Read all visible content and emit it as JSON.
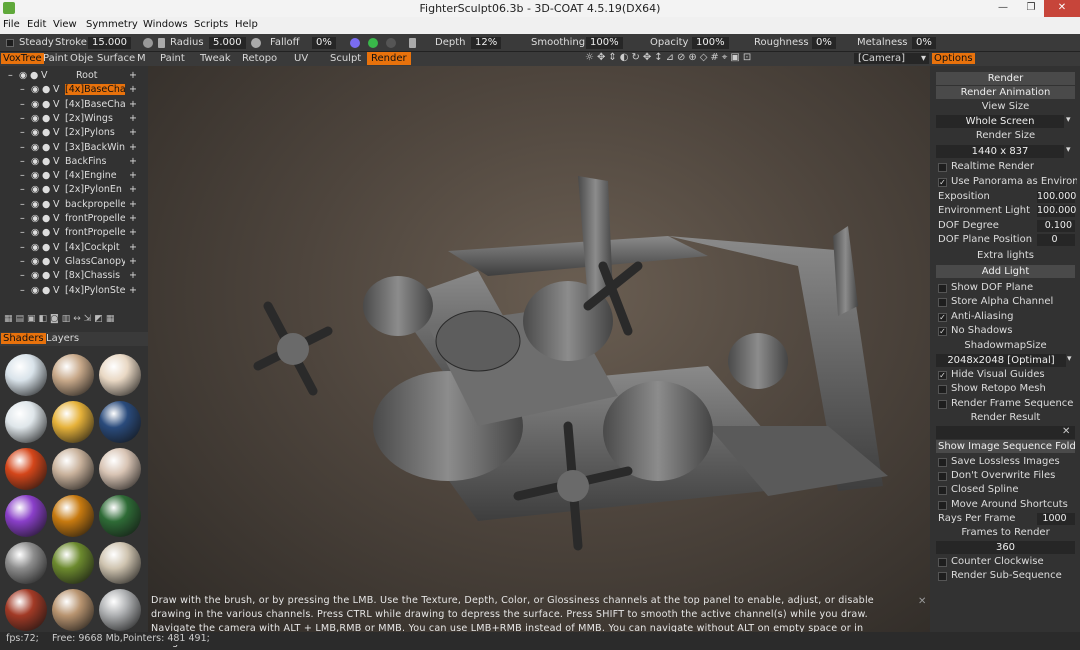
{
  "window": {
    "title": "FighterSculpt06.3b - 3D-COAT 4.5.19(DX64)",
    "min": "—",
    "max": "❐",
    "close": "✕"
  },
  "menu": [
    "File",
    "Edit",
    "View",
    "Symmetry",
    "Windows",
    "Scripts",
    "Help"
  ],
  "toolbar": {
    "steady": "Steady",
    "stroke_label": "Stroke",
    "stroke_value": "15.000",
    "radius_label": "Radius",
    "radius_value": "5.000",
    "falloff_label": "Falloff",
    "falloff_value": "0%",
    "depth_label": "Depth",
    "depth_value": "12%",
    "smoothing_label": "Smoothing",
    "smoothing_value": "100%",
    "opacity_label": "Opacity",
    "opacity_value": "100%",
    "roughness_label": "Roughness",
    "roughness_value": "0%",
    "metalness_label": "Metalness",
    "metalness_value": "0%"
  },
  "left_tabs": [
    "VoxTree",
    "Paint",
    "Obje",
    "Surface",
    "M"
  ],
  "voxtree": {
    "root": "Root",
    "items": [
      "[4x]BaseCha",
      "[4x]BaseCha",
      "[2x]Wings",
      "[2x]Pylons",
      "[3x]BackWin",
      "BackFins",
      "[4x]Engine",
      "[2x]PylonEn",
      "backpropelle",
      "frontPropelle",
      "frontPropelle",
      "[4x]Cockpit",
      "GlassCanopy",
      "[8x]Chassis",
      "[4x]PylonSte"
    ],
    "visible_mark": "V",
    "add": "+"
  },
  "shader_tabs": [
    "Shaders",
    "Layers"
  ],
  "room_tabs": [
    "Paint",
    "Tweak",
    "Retopo",
    "UV",
    "Sculpt",
    "Render"
  ],
  "camera_select": "[Camera]",
  "options_tab": "Options",
  "render_panel": {
    "render_btn": "Render",
    "render_anim_btn": "Render Animation",
    "view_size_title": "View Size",
    "view_size_value": "Whole Screen",
    "render_size_title": "Render Size",
    "render_size_value": "1440  x  837",
    "realtime": "Realtime Render",
    "use_panorama": "Use Panorama as Environm",
    "exposition_label": "Exposition",
    "exposition_value": "100.000",
    "env_light_label": "Environment Light",
    "env_light_value": "100.000",
    "dof_degree_label": "DOF Degree",
    "dof_degree_value": "0.100",
    "dof_plane_label": "DOF Plane Position",
    "dof_plane_value": "0",
    "extra_lights": "Extra lights",
    "add_light": "Add Light",
    "show_dof": "Show DOF Plane",
    "store_alpha": "Store Alpha Channel",
    "anti_alias": "Anti-Aliasing",
    "no_shadows": "No Shadows",
    "shadowmap_title": "ShadowmapSize",
    "shadowmap_value": "2048x2048 [Optimal]",
    "hide_guides": "Hide Visual Guides",
    "show_retopo": "Show Retopo Mesh",
    "render_frame_seq": "Render Frame Sequence",
    "render_result": "Render Result",
    "show_image_seq": "Show Image Sequence Folde",
    "save_lossless": "Save Lossless Images",
    "dont_overwrite": "Don't Overwrite Files",
    "closed_spline": "Closed Spline",
    "move_around": "Move Around Shortcuts",
    "rays_label": "Rays Per Frame",
    "rays_value": "1000",
    "frames_title": "Frames to Render",
    "frames_value": "360",
    "counter_clockwise": "Counter Clockwise",
    "render_subseq": "Render Sub-Sequence"
  },
  "hint_text": "Draw with the brush, or by pressing the LMB. Use the Texture, Depth, Color, or Glossiness channels at the top panel to enable, adjust, or disable drawing in the various channels. Press CTRL while drawing to depress the surface. Press SHIFT to smooth the active channel(s) while you draw. Navigate the camera with ALT + LMB,RMB or MMB. You can use LMB+RMB instead of MMB. You can navigate without ALT on empty space or in navigation zone",
  "status": {
    "fps": "fps:72;",
    "free": "Free: 9668 Mb,Pointers: 481 491;"
  },
  "colors": {
    "accent": "#e8720c",
    "panel": "#323232",
    "viewport": "#4e453d"
  }
}
